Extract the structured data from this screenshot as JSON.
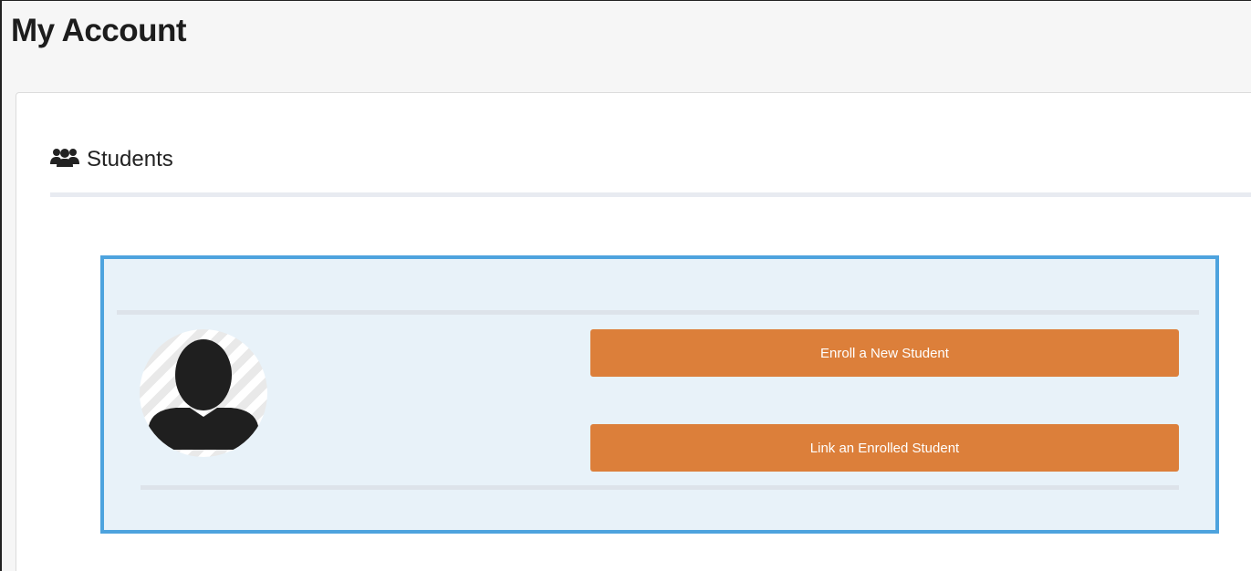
{
  "page": {
    "title": "My Account"
  },
  "students_section": {
    "icon": "users-icon",
    "title": "Students"
  },
  "student_card": {
    "avatar_icon": "user-silhouette-icon",
    "enroll_button_label": "Enroll a New Student",
    "link_button_label": "Link an Enrolled Student"
  },
  "colors": {
    "accent_button": "#dc7f3a",
    "card_border": "#4da3de",
    "card_background": "#e8f2f9"
  }
}
